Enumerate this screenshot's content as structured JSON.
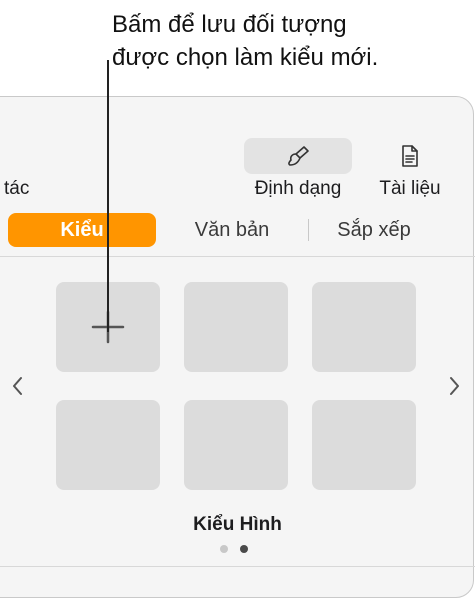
{
  "callout": {
    "text_line1": "Bấm để lưu đối tượng",
    "text_line2": "được chọn làm kiểu mới."
  },
  "toolbar": {
    "partial_label": "tác",
    "format_button": {
      "label": "Định dạng",
      "icon": "paintbrush-icon",
      "active": true
    },
    "document_button": {
      "label": "Tài liệu",
      "icon": "document-icon",
      "active": false
    }
  },
  "tabs": [
    {
      "label": "Kiểu",
      "selected": true
    },
    {
      "label": "Văn bản",
      "selected": false
    },
    {
      "label": "Sắp xếp",
      "selected": false
    }
  ],
  "styles_grid": {
    "tiles": [
      {
        "kind": "add-style",
        "icon": "plus-icon"
      },
      {
        "kind": "style"
      },
      {
        "kind": "style"
      },
      {
        "kind": "style"
      },
      {
        "kind": "style"
      },
      {
        "kind": "style"
      }
    ]
  },
  "navigation": {
    "prev_icon": "chevron-left-icon",
    "next_icon": "chevron-right-icon"
  },
  "page_title": "Kiểu Hình",
  "pagination": {
    "total": 2,
    "current": 2
  },
  "colors": {
    "accent": "#ff9500",
    "tile": "#dcdcdc",
    "panel": "#f5f5f5"
  }
}
